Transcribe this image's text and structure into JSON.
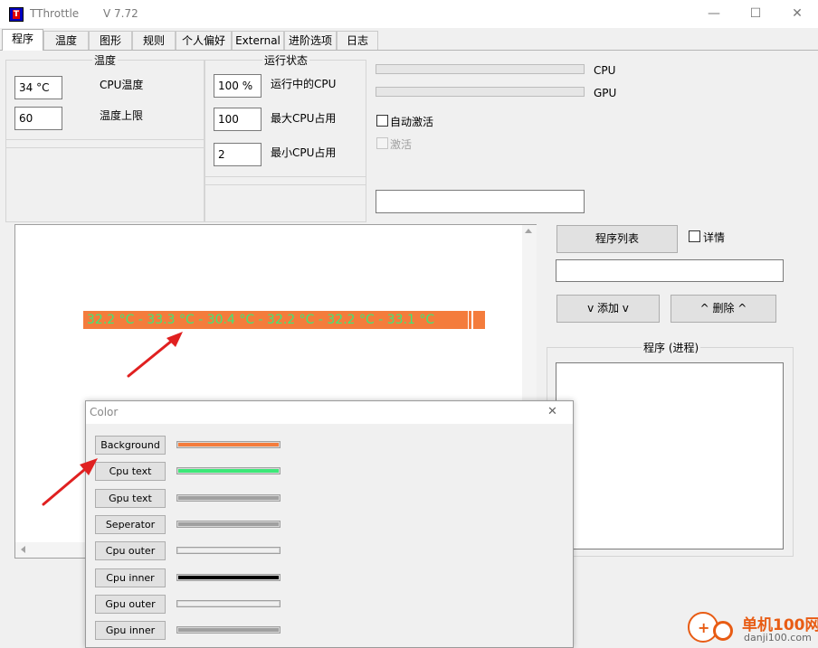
{
  "app": {
    "title": "TThrottle",
    "version": "V 7.72",
    "icon_letter": "T"
  },
  "window_controls": {
    "minimize": "—",
    "maximize": "☐",
    "close": "✕"
  },
  "tabs": [
    {
      "label": "程序",
      "active": true
    },
    {
      "label": "温度"
    },
    {
      "label": "图形"
    },
    {
      "label": "规则"
    },
    {
      "label": "个人偏好"
    },
    {
      "label": "External"
    },
    {
      "label": "进阶选项"
    },
    {
      "label": "日志"
    }
  ],
  "temperature": {
    "group_label": "温度",
    "cpu_temp_value": "34 °C",
    "cpu_temp_label": "CPU温度",
    "limit_value": "60",
    "limit_label": "温度上限"
  },
  "run_state": {
    "group_label": "运行状态",
    "running_cpu_value": "100 %",
    "running_cpu_label": "运行中的CPU",
    "max_cpu_value": "100",
    "max_cpu_label": "最大CPU占用",
    "min_cpu_value": "2",
    "min_cpu_label": "最小CPU占用"
  },
  "load_bars": {
    "cpu_label": "CPU",
    "gpu_label": "GPU"
  },
  "auto_activate": {
    "label": "自动激活",
    "checked": false
  },
  "activate": {
    "label": "激活",
    "checked": false,
    "disabled": true
  },
  "status_field": {
    "value": ""
  },
  "temp_strip": {
    "text": "32.2 °C - 33.3 °C - 30.4 °C - 32.2 °C - 32.2 °C - 33.1 °C",
    "background_color": "#f47c3c",
    "cpu_text_color": "#3ce878"
  },
  "right_panel": {
    "program_list_button": "程序列表",
    "details_label": "详情",
    "add_button": "v 添加 v",
    "remove_button": "^ 删除 ^",
    "programs_group_label": "程序 (进程)"
  },
  "color_dialog": {
    "title": "Color",
    "close": "✕",
    "items": [
      {
        "label": "Background",
        "color": "#f47c3c"
      },
      {
        "label": "Cpu text",
        "color": "#3ce878"
      },
      {
        "label": "Gpu text",
        "color": "#a0a0a0"
      },
      {
        "label": "Seperator",
        "color": "#a0a0a0"
      },
      {
        "label": "Cpu outer",
        "color": "#f0f0f0"
      },
      {
        "label": "Cpu inner",
        "color": "#000000"
      },
      {
        "label": "Gpu outer",
        "color": "#f0f0f0"
      },
      {
        "label": "Gpu inner",
        "color": "#a0a0a0"
      }
    ]
  },
  "watermark": {
    "brand": "单机100网",
    "url": "danji100.com"
  }
}
